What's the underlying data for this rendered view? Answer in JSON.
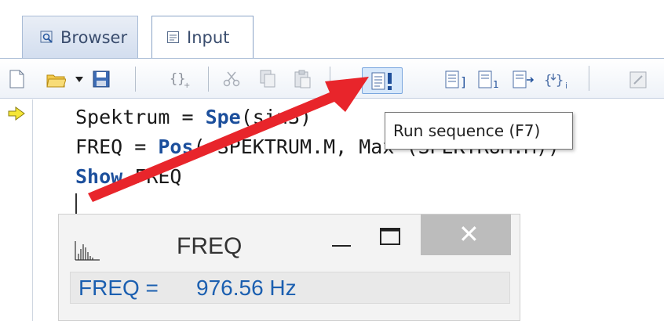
{
  "tabs": {
    "browser_label": "Browser",
    "input_label": "Input"
  },
  "toolbar": {
    "icons": [
      "new-file-icon",
      "open-folder-icon",
      "dropdown-arrow-icon",
      "save-icon",
      "braces-icon",
      "cut-icon",
      "copy-icon",
      "paste-icon",
      "run-sequence-icon",
      "step-icon",
      "step-into-icon",
      "step-over-icon",
      "step-out-icon",
      "edit-icon"
    ],
    "run_tooltip": "Run sequence (F7)"
  },
  "editor": {
    "line1": {
      "var": "Spektrum = ",
      "func": "Spe",
      "rest": "(sin3)"
    },
    "line2": {
      "var": "FREQ = ",
      "func": "Pos",
      "rest": "( SPEKTRUM.M, Max (SPEKTRUM.M))"
    },
    "line3": {
      "kw": "Show",
      "rest": " FREQ"
    }
  },
  "result_window": {
    "title": "FREQ",
    "minimize": "—",
    "close": "✕",
    "label": "FREQ =",
    "value": "976.56 Hz"
  },
  "colors": {
    "accent": "#1b5fb0",
    "annotation": "#e8252b",
    "keyword": "#1c4f9c"
  }
}
